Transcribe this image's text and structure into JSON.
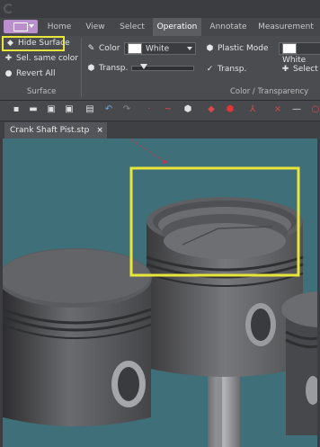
{
  "ribbon": {
    "tabs": [
      "Home",
      "View",
      "Select",
      "Operation",
      "Annotate",
      "Measurement"
    ],
    "active_tab": "Operation",
    "surface_group": {
      "hide_surface": "Hide Surface",
      "select_same_color": "Sel. same color",
      "revert_all": "Revert All",
      "label": "Surface"
    },
    "color_group": {
      "color_label": "Color",
      "color_value": "White",
      "transp_label": "Transp.",
      "plastic_mode": "Plastic Mode",
      "transp_check_label": "Transp.",
      "second_color_value": "White",
      "select_label": "Select",
      "label": "Color / Transparency",
      "transparency_level": 0.15
    }
  },
  "document": {
    "tab_label": "Crank Shaft Pist.stp",
    "close_glyph": "×"
  },
  "colors": {
    "highlight": "#e8e63a",
    "viewport_bg": "#3f6f79",
    "ribbon_bg": "#4a4c50"
  }
}
